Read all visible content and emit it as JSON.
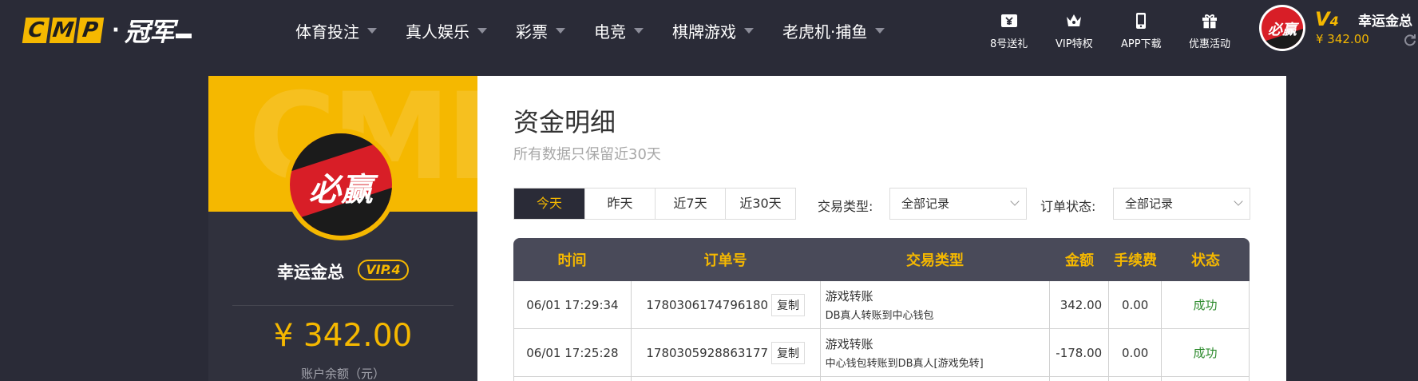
{
  "header": {
    "logo": {
      "letters": [
        "C",
        "M",
        "P"
      ],
      "dot": "·",
      "cn": "冠军"
    },
    "nav": [
      {
        "label": "体育投注"
      },
      {
        "label": "真人娱乐"
      },
      {
        "label": "彩票"
      },
      {
        "label": "电竞"
      },
      {
        "label": "棋牌游戏"
      },
      {
        "label": "老虎机·捕鱼"
      }
    ],
    "quick_links": [
      {
        "label": "8号送礼",
        "icon": "ticket-icon"
      },
      {
        "label": "VIP特权",
        "icon": "crown-icon"
      },
      {
        "label": "APP下载",
        "icon": "phone-icon"
      },
      {
        "label": "优惠活动",
        "icon": "gift-icon"
      }
    ],
    "user": {
      "avatar_text": "必赢",
      "vip_letter": "V",
      "vip_level": "4",
      "name": "幸运金总",
      "balance": "¥ 342.00",
      "refresh_icon": "refresh-icon"
    }
  },
  "profile": {
    "watermark": "CMP",
    "avatar_text": "必赢",
    "name": "幸运金总",
    "vip": "VIP.4",
    "balance": "¥ 342.00",
    "balance_label": "账户余额（元）"
  },
  "content": {
    "title": "资金明细",
    "subtitle": "所有数据只保留近30天",
    "tabs": [
      {
        "label": "今天",
        "active": true
      },
      {
        "label": "昨天",
        "active": false
      },
      {
        "label": "近7天",
        "active": false
      },
      {
        "label": "近30天",
        "active": false
      }
    ],
    "filters": {
      "type_label": "交易类型:",
      "type_value": "全部记录",
      "status_label": "订单状态:",
      "status_value": "全部记录"
    },
    "table": {
      "headers": [
        "时间",
        "订单号",
        "交易类型",
        "金额",
        "手续费",
        "状态"
      ],
      "copy_label": "复制",
      "rows": [
        {
          "time": "06/01 17:29:34",
          "order": "1780306174796180",
          "type": "游戏转账",
          "type_detail": "DB真人转账到中心钱包",
          "amount": "342.00",
          "fee": "0.00",
          "status": "成功"
        },
        {
          "time": "06/01 17:25:28",
          "order": "1780305928863177",
          "type": "游戏转账",
          "type_detail": "中心钱包转账到DB真人[游戏免转]",
          "amount": "-178.00",
          "fee": "0.00",
          "status": "成功"
        }
      ]
    }
  },
  "colors": {
    "brand_yellow": "#f5b800",
    "dark_bg": "#2a2b37",
    "table_head": "#494a59",
    "success": "#2e8b2e"
  }
}
